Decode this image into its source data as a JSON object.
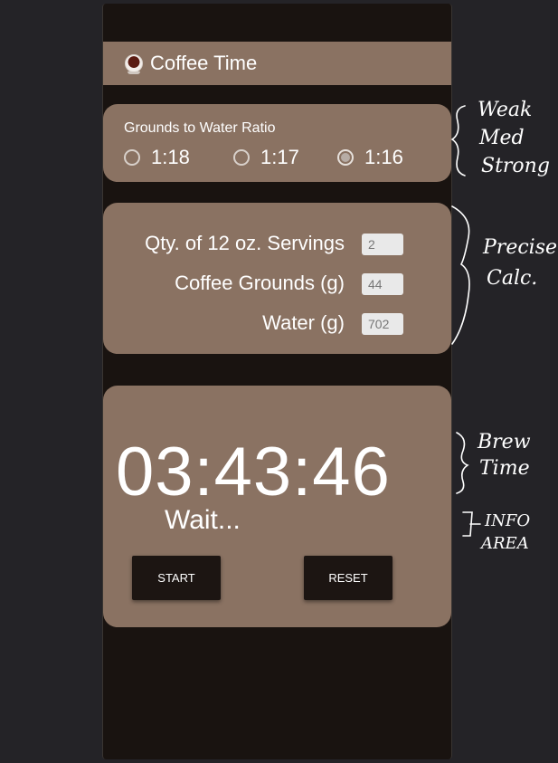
{
  "app": {
    "icon": "coffee-cup-icon",
    "title": "Coffee Time"
  },
  "ratio": {
    "label": "Grounds to Water Ratio",
    "options": [
      {
        "label": "1:18",
        "selected": false
      },
      {
        "label": "1:17",
        "selected": false
      },
      {
        "label": "1:16",
        "selected": true
      }
    ]
  },
  "calc": {
    "servings_label": "Qty. of 12 oz. Servings",
    "servings_value": "2",
    "grounds_label": "Coffee Grounds (g)",
    "grounds_value": "44",
    "water_label": "Water (g)",
    "water_value": "702"
  },
  "timer": {
    "time": "03:43:46",
    "info": "Wait...",
    "start_label": "START",
    "reset_label": "RESET"
  },
  "annotations": {
    "ratio_note_1": "Weak",
    "ratio_note_2": "Med",
    "ratio_note_3": "Strong",
    "calc_note_1": "Precise",
    "calc_note_2": "Calc.",
    "time_note_1": "Brew",
    "time_note_2": "Time",
    "info_note_1": "INFO",
    "info_note_2": "AREA"
  },
  "colors": {
    "background": "#242327",
    "phone": "#191310",
    "card": "#8a7262",
    "button": "#1c1512"
  }
}
